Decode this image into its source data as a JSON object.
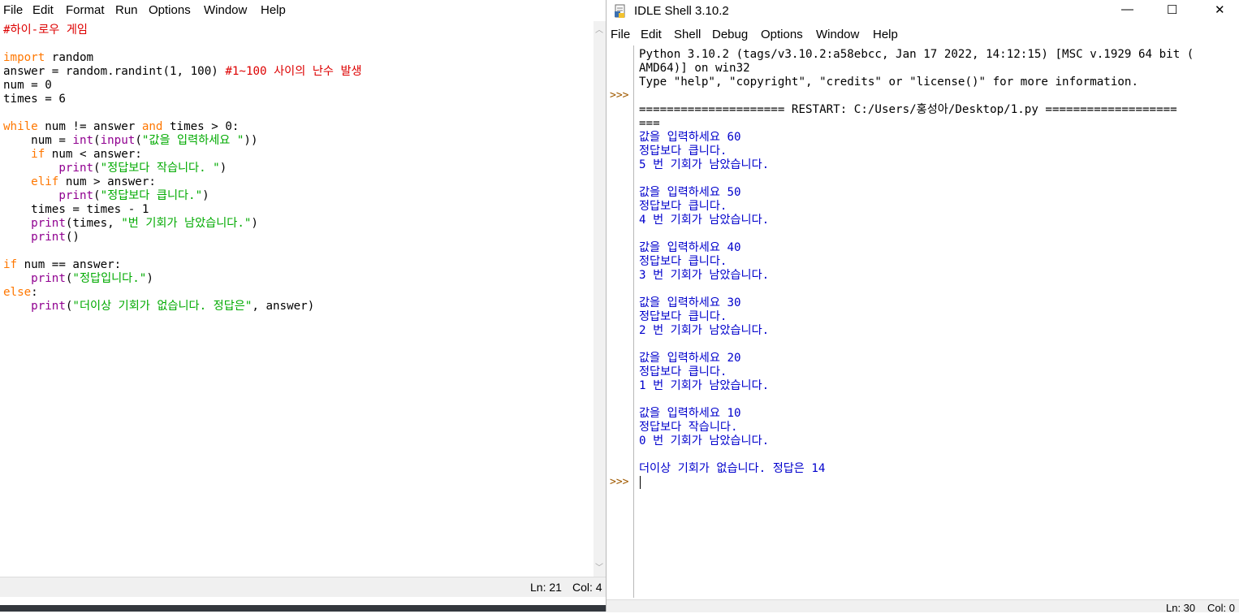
{
  "editor": {
    "menu": [
      "File",
      "Edit",
      "Format",
      "Run",
      "Options",
      "Window",
      "Help"
    ],
    "code": {
      "l1": "#하이-로우 게임",
      "l3_kw": "import",
      "l3_rest": " random",
      "l4_code": "answer = random.randint(1, 100) ",
      "l4_comment": "#1~100 사이의 난수 발생",
      "l5": "num = 0",
      "l6": "times = 6",
      "l8_kw1": "while",
      "l8_mid": " num != answer ",
      "l8_kw2": "and",
      "l8_end": " times > 0:",
      "l9_pre": "    num = ",
      "l9_bi1": "int",
      "l9_p": "(",
      "l9_bi2": "input",
      "l9_p2": "(",
      "l9_str": "\"값을 입력하세요 \"",
      "l9_end": "))",
      "l10_kw": "    if",
      "l10_rest": " num < answer:",
      "l11_bi": "        print",
      "l11_p": "(",
      "l11_str": "\"정답보다 작습니다. \"",
      "l11_end": ")",
      "l12_kw": "    elif",
      "l12_rest": " num > answer:",
      "l13_bi": "        print",
      "l13_p": "(",
      "l13_str": "\"정답보다 큽니다.\"",
      "l13_end": ")",
      "l14": "    times = times - 1",
      "l15_bi": "    print",
      "l15_mid": "(times, ",
      "l15_str": "\"번 기회가 남았습니다.\"",
      "l15_end": ")",
      "l16_bi": "    print",
      "l16_end": "()",
      "l18_kw": "if",
      "l18_rest": " num == answer:",
      "l19_bi": "    print",
      "l19_p": "(",
      "l19_str": "\"정답입니다.\"",
      "l19_end": ")",
      "l20_kw": "else",
      "l20_end": ":",
      "l21_bi": "    print",
      "l21_p": "(",
      "l21_str": "\"더이상 기회가 없습니다. 정답은\"",
      "l21_end": ", answer)"
    },
    "status": {
      "line": "Ln: 21",
      "col": "Col: 4"
    }
  },
  "shell": {
    "title": "IDLE Shell 3.10.2",
    "window_buttons": {
      "minimize": "—",
      "maximize": "☐",
      "close": "✕"
    },
    "menu": [
      "File",
      "Edit",
      "Shell",
      "Debug",
      "Options",
      "Window",
      "Help"
    ],
    "prompt": ">>>",
    "banner": [
      "Python 3.10.2 (tags/v3.10.2:a58ebcc, Jan 17 2022, 14:12:15) [MSC v.1929 64 bit (",
      "AMD64)] on win32",
      "Type \"help\", \"copyright\", \"credits\" or \"license()\" for more information."
    ],
    "restart": [
      "===================== RESTART: C:/Users/홍성아/Desktop/1.py ===================",
      "==="
    ],
    "output": [
      "값을 입력하세요 60",
      "정답보다 큽니다.",
      "5 번 기회가 남았습니다.",
      "",
      "값을 입력하세요 50",
      "정답보다 큽니다.",
      "4 번 기회가 남았습니다.",
      "",
      "값을 입력하세요 40",
      "정답보다 큽니다.",
      "3 번 기회가 남았습니다.",
      "",
      "값을 입력하세요 30",
      "정답보다 큽니다.",
      "2 번 기회가 남았습니다.",
      "",
      "값을 입력하세요 20",
      "정답보다 큽니다.",
      "1 번 기회가 남았습니다.",
      "",
      "값을 입력하세요 10",
      "정답보다 작습니다.",
      "0 번 기회가 남았습니다.",
      "",
      "더이상 기회가 없습니다. 정답은 14"
    ],
    "status": {
      "line": "Ln: 30",
      "col": "Col: 0"
    }
  }
}
